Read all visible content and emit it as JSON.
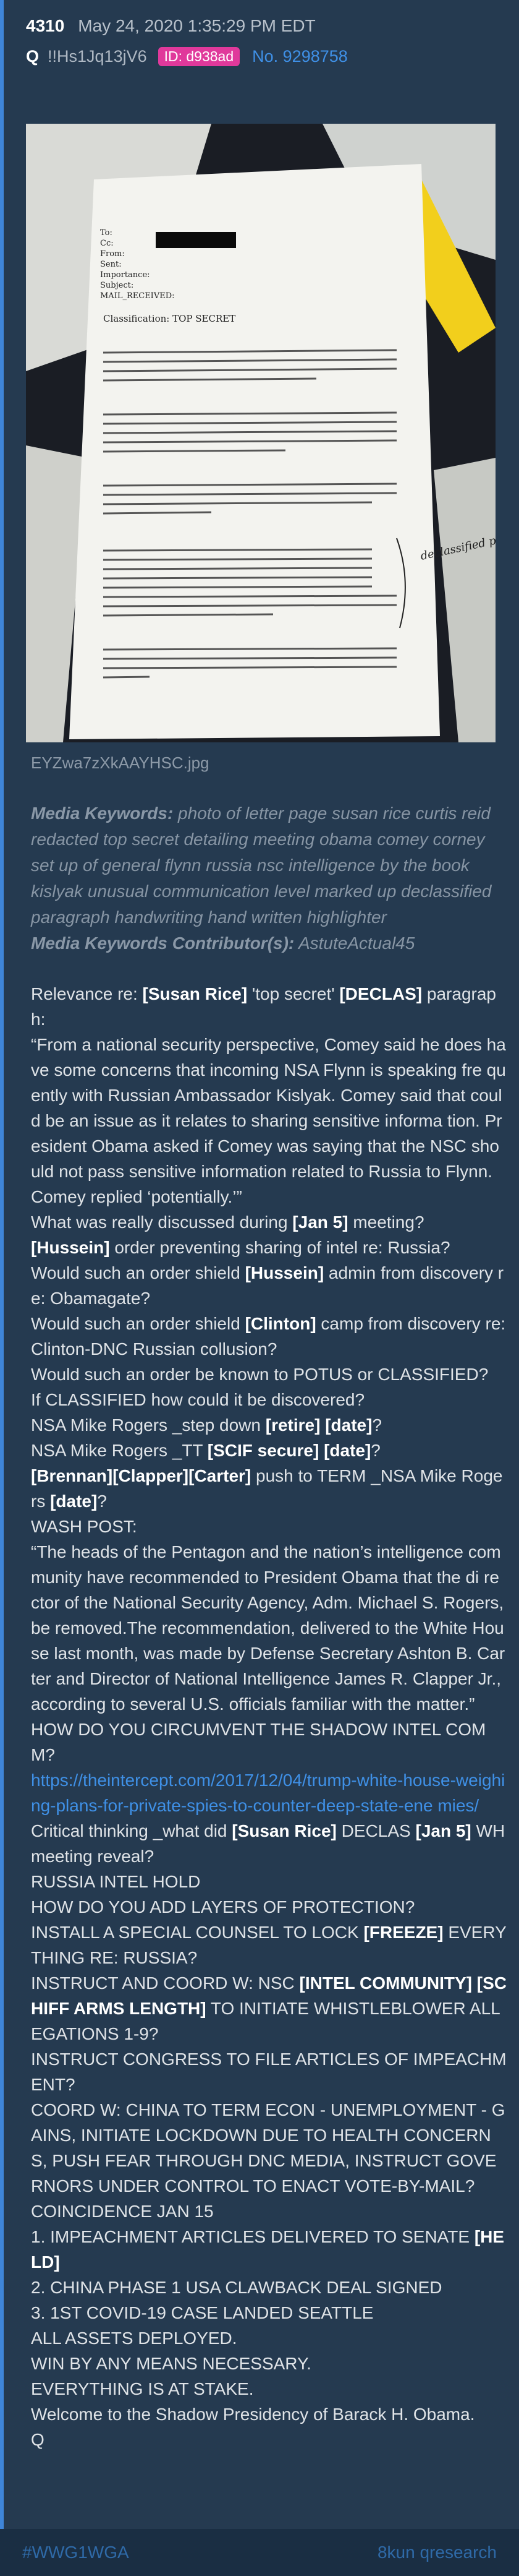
{
  "post": {
    "number": "4310",
    "date": "May 24, 2020 1:35:29 PM EDT",
    "name": "Q",
    "tripcode": "!!Hs1Jq13jV6",
    "id_badge": "ID: d938ad",
    "post_link": "No. 9298758"
  },
  "image": {
    "filename": "EYZwa7zXkAAYHSC.jpg",
    "alt": "photo of letter page",
    "doc_lines": {
      "classification": "Classification: TOP SECRET",
      "handwriting": "declassified per jn",
      "to": "To:",
      "cc": "Cc:",
      "from": "From:",
      "sent": "Sent:",
      "importance": "Importance:",
      "subject": "Subject:",
      "mail_received": "MAIL_RECEIVED:"
    }
  },
  "keywords": {
    "label": "Media Keywords:",
    "text": " photo of letter page susan rice curtis reid redacted top secret detailing meeting obama comey corney set up of general flynn russia nsc intelligence by the book kislyak unusual communication level marked up declassified paragraph handwriting hand written highlighter",
    "contrib_label": "Media Keywords Contributor(s):",
    "contrib_value": " AstuteActual45"
  },
  "body_lines": [
    [
      {
        "t": "Relevance re: "
      },
      {
        "t": "[Susan Rice]",
        "b": true
      },
      {
        "t": " 'top secret' "
      },
      {
        "t": "[DECLAS]",
        "b": true
      },
      {
        "t": " paragraph:"
      }
    ],
    [
      {
        "t": "“From a national security perspective, Comey said he does have some concerns that incoming NSA Flynn is speaking fre quently with Russian Ambassador Kislyak. Comey said that could be an issue as it relates to sharing sensitive informa tion. President Obama asked if Comey was saying that the NSC should not pass sensitive information related to Russia to Flynn. Comey replied ‘potentially.’”"
      }
    ],
    [
      {
        "t": "What was really discussed during "
      },
      {
        "t": "[Jan 5]",
        "b": true
      },
      {
        "t": " meeting?"
      }
    ],
    [
      {
        "t": "[Hussein]",
        "b": true
      },
      {
        "t": " order preventing sharing of intel re: Russia?"
      }
    ],
    [
      {
        "t": "Would such an order shield "
      },
      {
        "t": "[Hussein]",
        "b": true
      },
      {
        "t": " admin from discovery re: Obamagate?"
      }
    ],
    [
      {
        "t": "Would such an order shield "
      },
      {
        "t": "[Clinton]",
        "b": true
      },
      {
        "t": " camp from discovery re: Clinton-DNC Russian collusion?"
      }
    ],
    [
      {
        "t": "Would such an order be known to POTUS or CLASSIFIED?"
      }
    ],
    [
      {
        "t": "If CLASSIFIED how could it be discovered?"
      }
    ],
    [
      {
        "t": "NSA Mike Rogers _step down "
      },
      {
        "t": "[retire] [date]",
        "b": true
      },
      {
        "t": "?"
      }
    ],
    [
      {
        "t": "NSA Mike Rogers _TT "
      },
      {
        "t": "[SCIF secure] [date]",
        "b": true
      },
      {
        "t": "?"
      }
    ],
    [
      {
        "t": "[Brennan][Clapper][Carter]",
        "b": true
      },
      {
        "t": " push to TERM _NSA Mike Rogers "
      },
      {
        "t": "[date]",
        "b": true
      },
      {
        "t": "?"
      }
    ],
    [
      {
        "t": "WASH POST:"
      }
    ],
    [
      {
        "t": "“The heads of the Pentagon and the nation’s intelligence com munity have recommended to President Obama that the di rector of the National Security Agency, Adm. Michael S. Rogers, be removed.The recommendation, delivered to the White House last month, was made by Defense Secretary Ashton B. Carter and Director of National Intelligence James R. Clapper Jr., according to several U.S. officials familiar with the matter.”"
      }
    ],
    [
      {
        "t": "HOW DO YOU CIRCUMVENT THE SHADOW INTEL COMM?"
      }
    ],
    [
      {
        "t": "https://theintercept.com/2017/12/04/trump-white-house-weighing-plans-for-private-spies-to-counter-deep-state-ene mies/",
        "link": true
      }
    ],
    [
      {
        "t": "Critical thinking _what did "
      },
      {
        "t": "[Susan Rice]",
        "b": true
      },
      {
        "t": " DECLAS "
      },
      {
        "t": "[Jan 5]",
        "b": true
      },
      {
        "t": " WH meeting reveal?"
      }
    ],
    [
      {
        "t": "RUSSIA INTEL HOLD"
      }
    ],
    [
      {
        "t": "HOW DO YOU ADD LAYERS OF PROTECTION?"
      }
    ],
    [
      {
        "t": "INSTALL A SPECIAL COUNSEL TO LOCK "
      },
      {
        "t": "[FREEZE]",
        "b": true
      },
      {
        "t": " EVERYTHING RE: RUSSIA?"
      }
    ],
    [
      {
        "t": "INSTRUCT AND COORD W: NSC "
      },
      {
        "t": "[INTEL COMMUNITY] [SCHIFF ARMS LENGTH]",
        "b": true
      },
      {
        "t": " TO INITIATE WHISTLEBLOWER ALLEGATIONS 1-9?"
      }
    ],
    [
      {
        "t": "INSTRUCT CONGRESS TO FILE ARTICLES OF IMPEACHMENT?"
      }
    ],
    [
      {
        "t": "COORD W: CHINA TO TERM ECON - UNEMPLOYMENT - GAINS, INITIATE LOCKDOWN DUE TO HEALTH CONCERNS, PUSH FEAR THROUGH DNC MEDIA, INSTRUCT GOVERNORS UNDER CONTROL TO ENACT VOTE-BY-MAIL?"
      }
    ],
    [
      {
        "t": "COINCIDENCE JAN 15"
      }
    ],
    [
      {
        "t": "1. IMPEACHMENT ARTICLES DELIVERED TO SENATE "
      },
      {
        "t": "[HELD]",
        "b": true
      }
    ],
    [
      {
        "t": "2. CHINA PHASE 1 USA CLAWBACK DEAL SIGNED"
      }
    ],
    [
      {
        "t": "3. 1ST COVID-19 CASE LANDED SEATTLE"
      }
    ],
    [
      {
        "t": "ALL ASSETS DEPLOYED."
      }
    ],
    [
      {
        "t": "WIN BY ANY MEANS NECESSARY."
      }
    ],
    [
      {
        "t": "EVERYTHING IS AT STAKE."
      }
    ],
    [
      {
        "t": "Welcome to the Shadow Presidency of Barack H. Obama."
      }
    ],
    [
      {
        "t": "Q"
      }
    ]
  ],
  "footer": {
    "hashtag": "#WWG1WGA",
    "source": "8kun qresearch"
  },
  "colors": {
    "accent_bar": "#3f85d8",
    "id_badge": "#e0399b",
    "link": "#3f90e6"
  }
}
